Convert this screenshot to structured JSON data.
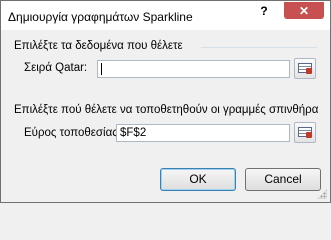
{
  "window": {
    "title": "Δημιουργία γραφημάτων Sparkline",
    "help_label": "?",
    "close_label": "✕"
  },
  "data_section": {
    "heading": "Επιλέξτε τα δεδομένα που θέλετε",
    "field_label": "Σειρά Qatar:",
    "value": ""
  },
  "location_section": {
    "heading": "Επιλέξτε πού θέλετε να τοποθετηθούν οι γραμμές σπινθήρα",
    "field_label": "Εύρος τοποθεσίας:",
    "value": "$F$2"
  },
  "buttons": {
    "ok": "OK",
    "cancel": "Cancel"
  },
  "icons": {
    "help": "help-icon",
    "close": "close-icon",
    "range_picker": "collapse-dialog-icon",
    "resize": "resize-grip-icon"
  }
}
